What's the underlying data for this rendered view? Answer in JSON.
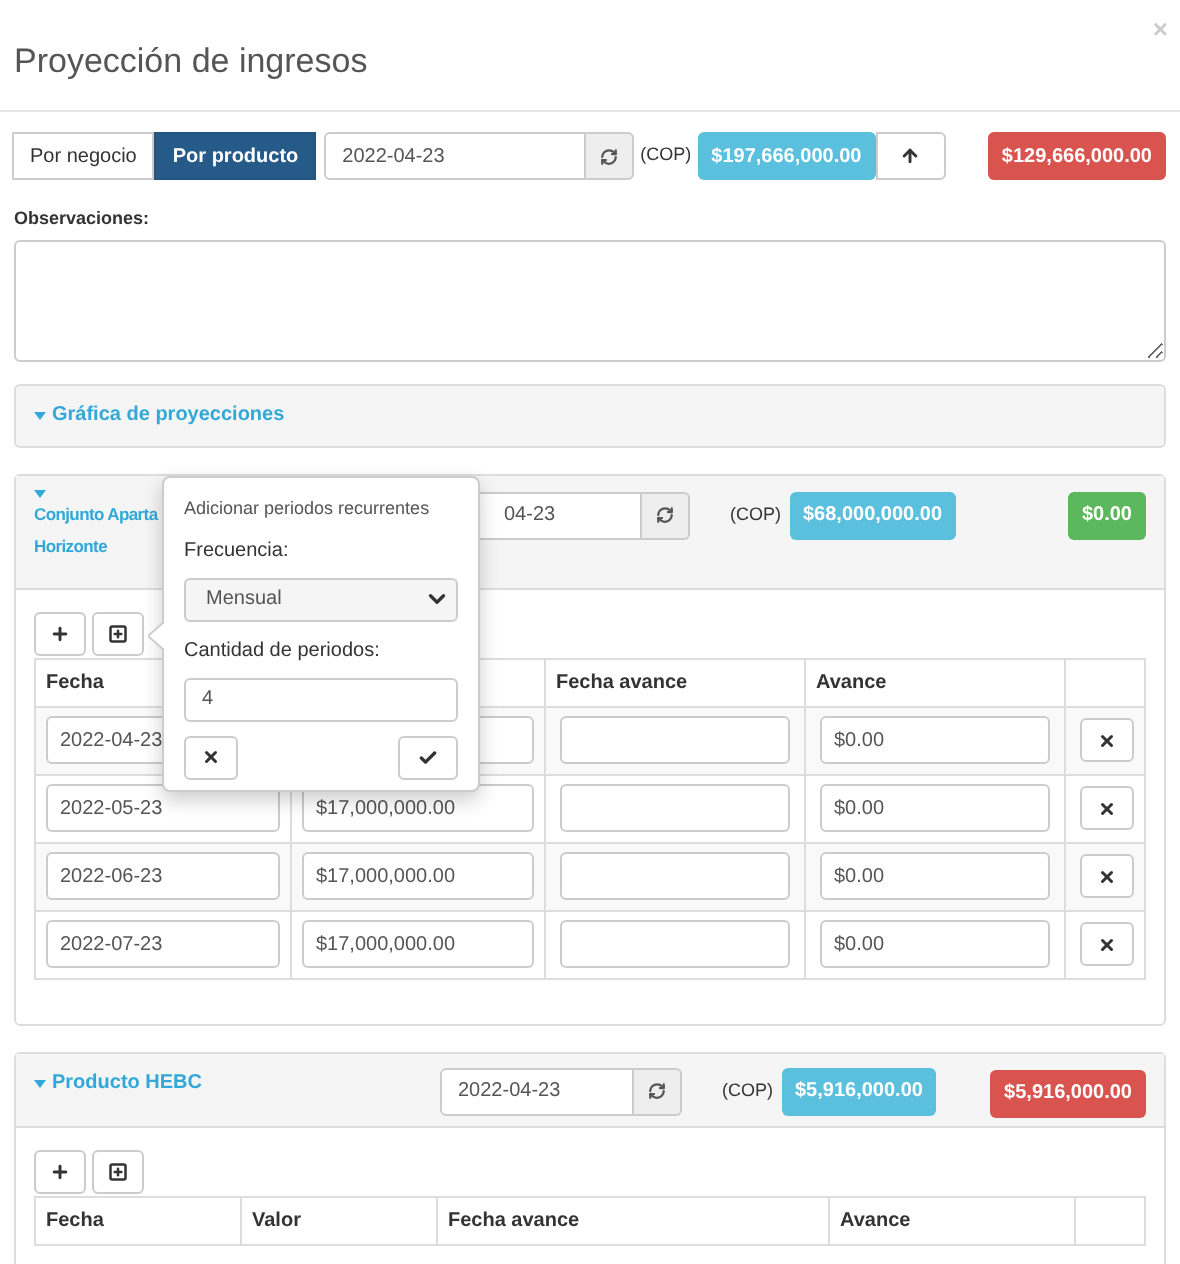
{
  "dialog": {
    "title": "Proyección de ingresos",
    "close": "×"
  },
  "toolbar": {
    "view_tabs": [
      {
        "label": "Por negocio",
        "selected": false
      },
      {
        "label": "Por producto",
        "selected": true
      }
    ],
    "date": "2022-04-23",
    "currency": "(COP)",
    "total": "$197,666,000.00",
    "difference": "$129,666,000.00",
    "color": "#d9534f"
  },
  "observaciones": {
    "label": "Observaciones:"
  },
  "chart_section": {
    "title": "Gráfica de proyecciones"
  },
  "products": [
    {
      "title_lines": [
        "Conjunto Aparta",
        "Horizonte"
      ],
      "date": "04-23",
      "currency": "(COP)",
      "total": "$68,000,000.00",
      "difference": "$0.00",
      "color": "#5cb85c",
      "columns": [
        "Fecha",
        null,
        "Fecha avance",
        "Avance"
      ],
      "rows": [
        {
          "date": "2022-04-23",
          "advance": "$0.00"
        },
        {
          "date": "2022-05-23",
          "value": "$17,000,000.00",
          "advance": "$0.00"
        },
        {
          "date": "2022-06-23",
          "value": "$17,000,000.00",
          "advance": "$0.00"
        },
        {
          "date": "2022-07-23",
          "value": "$17,000,000.00",
          "advance": "$0.00"
        }
      ]
    },
    {
      "title_lines": [
        "Producto HEBC"
      ],
      "date": "2022-04-23",
      "currency": "(COP)",
      "total": "$5,916,000.00",
      "difference": "$5,916,000.00",
      "color": "#d9534f",
      "columns": [
        "Fecha",
        "Valor",
        "Fecha avance",
        "Avance"
      ]
    }
  ],
  "popover": {
    "title": "Adicionar periodos recurrentes",
    "frequency_label": "Frecuencia:",
    "frequency": "Mensual",
    "count_label": "Cantidad de periodos:",
    "count": "4"
  }
}
